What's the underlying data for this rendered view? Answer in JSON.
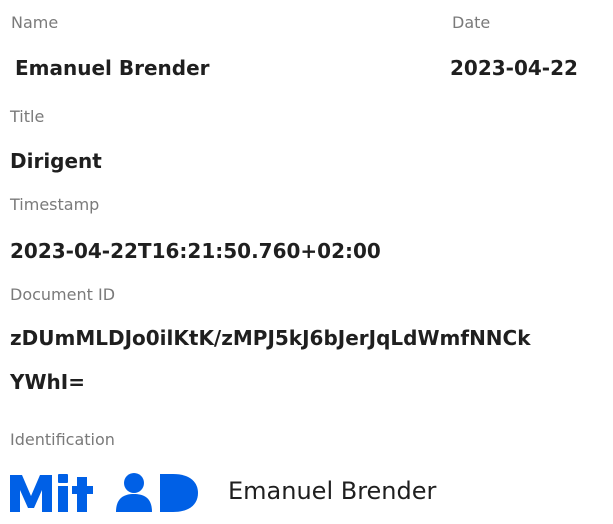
{
  "fields": {
    "name_label": "Name",
    "name_value": "Emanuel Brender",
    "date_label": "Date",
    "date_value": "2023-04-22",
    "title_label": "Title",
    "title_value": "Dirigent",
    "timestamp_label": "Timestamp",
    "timestamp_value": "2023-04-22T16:21:50.760+02:00",
    "document_id_label": "Document ID",
    "document_id_line1": "zDUmMLDJo0ilKtK/zMPJ5kJ6bJerJqLdWmfNNCk",
    "document_id_line2": "YWhI=",
    "identification_label": "Identification",
    "identification_name": "Emanuel Brender"
  },
  "logo": {
    "text": "MitID",
    "color": "#0060e6"
  }
}
